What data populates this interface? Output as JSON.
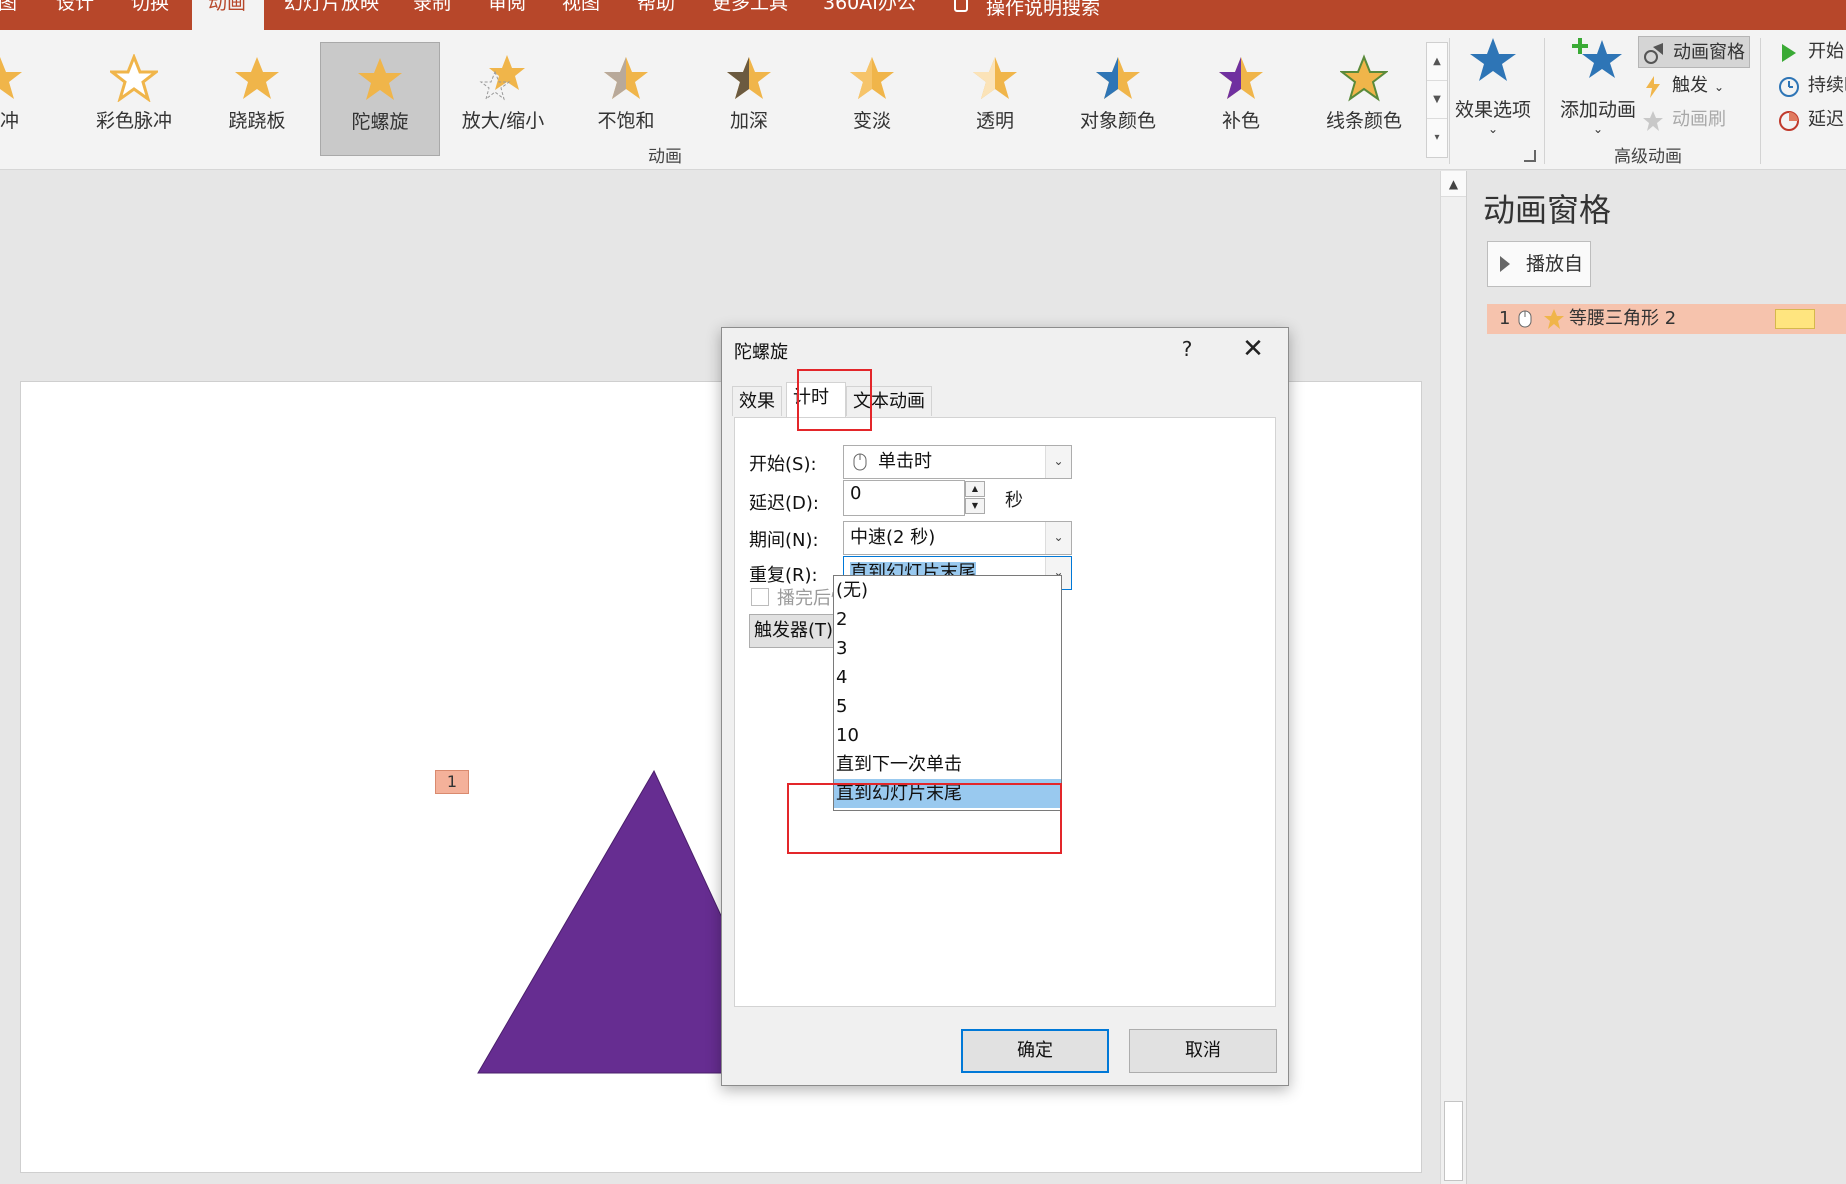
{
  "menu_tabs": [
    {
      "label": "图"
    },
    {
      "label": "设计"
    },
    {
      "label": "切换"
    },
    {
      "label": "动画"
    },
    {
      "label": "幻灯片放映"
    },
    {
      "label": "录制"
    },
    {
      "label": "审阅"
    },
    {
      "label": "视图"
    },
    {
      "label": "帮助"
    },
    {
      "label": "更多工具"
    },
    {
      "label": "360AI办公"
    },
    {
      "label": "操作说明搜索"
    }
  ],
  "active_tab": "动画",
  "effects": [
    {
      "label": "脉冲",
      "icon": "pulse-star-icon"
    },
    {
      "label": "彩色脉冲",
      "icon": "color-pulse-star-icon"
    },
    {
      "label": "跷跷板",
      "icon": "teeter-star-icon"
    },
    {
      "label": "陀螺旋",
      "icon": "spin-star-icon"
    },
    {
      "label": "放大/缩小",
      "icon": "grow-shrink-star-icon"
    },
    {
      "label": "不饱和",
      "icon": "desaturate-star-icon"
    },
    {
      "label": "加深",
      "icon": "darken-star-icon"
    },
    {
      "label": "变淡",
      "icon": "lighten-star-icon"
    },
    {
      "label": "透明",
      "icon": "transparency-star-icon"
    },
    {
      "label": "对象颜色",
      "icon": "object-color-star-icon"
    },
    {
      "label": "补色",
      "icon": "complementary-color-star-icon"
    },
    {
      "label": "线条颜色",
      "icon": "line-color-star-icon"
    }
  ],
  "selected_effect": "陀螺旋",
  "group_animation_label": "动画",
  "effect_options_label": "效果选项",
  "add_animation_label": "添加动画",
  "animation_pane_btn": "动画窗格",
  "trigger_label": "触发",
  "painter_label": "动画刷",
  "advanced_group_label": "高级动画",
  "timing": {
    "start": "开始:",
    "duration": "持续时",
    "delay": "延迟:"
  },
  "slide": {
    "anim_tag": "1",
    "shape_color": "#662d91"
  },
  "pane": {
    "title": "动画窗格",
    "play_label": "播放自",
    "item": {
      "num": "1",
      "name": "等腰三角形 2"
    }
  },
  "dialog": {
    "title": "陀螺旋",
    "help": "?",
    "close": "✕",
    "tabs": [
      "效果",
      "计时",
      "文本动画"
    ],
    "active_tab": "计时",
    "start_label": "开始(S):",
    "start_value": "单击时",
    "delay_label": "延迟(D):",
    "delay_value": "0",
    "delay_unit": "秒",
    "duration_label": "期间(N):",
    "duration_value": "中速(2 秒)",
    "repeat_label": "重复(R):",
    "repeat_value": "直到幻灯片末尾",
    "rewind_label": "播完后快退(W)",
    "trigger_btn": "触发器(T)",
    "repeat_options": [
      "(无)",
      "2",
      "3",
      "4",
      "5",
      "10",
      "直到下一次单击",
      "直到幻灯片末尾"
    ],
    "selected_option": "直到幻灯片末尾",
    "ok": "确定",
    "cancel": "取消"
  },
  "colors": {
    "accent": "#b7472a",
    "highlight": "#99c9ef",
    "annotation": "#e3262a",
    "star": "#f0b54a"
  }
}
